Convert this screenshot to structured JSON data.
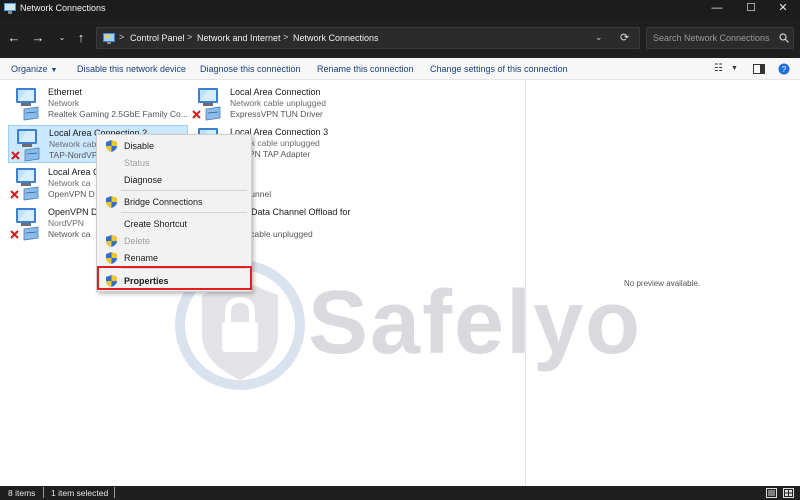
{
  "window": {
    "title": "Network Connections"
  },
  "window_controls": {
    "minimize": "—",
    "maximize": "☐",
    "close": "✕"
  },
  "nav": {
    "back": "←",
    "forward": "→",
    "recent": "⌄",
    "up": "↑"
  },
  "breadcrumb": {
    "items": [
      "Control Panel",
      "Network and Internet",
      "Network Connections"
    ],
    "separator": ">",
    "dropdown": "⌄",
    "refresh": "⟳"
  },
  "search": {
    "placeholder": "Search Network Connections"
  },
  "commands": {
    "organize": "Organize",
    "disable": "Disable this network device",
    "diagnose": "Diagnose this connection",
    "rename": "Rename this connection",
    "change": "Change settings of this connection"
  },
  "connections": [
    {
      "name": "Ethernet",
      "status": "Network",
      "device": "Realtek Gaming 2.5GbE Family Co...",
      "unplugged": false
    },
    {
      "name": "Local Area Connection",
      "status": "Network cable unplugged",
      "device": "ExpressVPN TUN Driver",
      "unplugged": true
    },
    {
      "name": "Local Area Connection 2",
      "status": "Network cab",
      "device": "TAP-NordVP",
      "unplugged": true,
      "selected": true
    },
    {
      "name": "Local Area Connection 3",
      "status": "etwork cable unplugged",
      "device": "essVPN TAP Adapter",
      "unplugged": true
    },
    {
      "name": "Local Area C",
      "status": "Network ca",
      "device": "OpenVPN D",
      "unplugged": true
    },
    {
      "name": "ynx",
      "status": "ynx",
      "device": "ynx Tunnel",
      "unplugged": true
    },
    {
      "name": "OpenVPN Da",
      "status": "NordVPN",
      "device": "Network ca",
      "unplugged": true
    },
    {
      "name": "VPN Data Channel Offload for",
      "status": "hark",
      "device": "work cable unplugged",
      "unplugged": true
    }
  ],
  "context_menu": {
    "disable": "Disable",
    "status": "Status",
    "diagnose": "Diagnose",
    "bridge": "Bridge Connections",
    "shortcut": "Create Shortcut",
    "delete": "Delete",
    "rename": "Rename",
    "properties": "Properties"
  },
  "preview": {
    "text": "No preview available."
  },
  "watermark": {
    "text": "Safelyo"
  },
  "statusbar": {
    "items_count": "8 items",
    "selected": "1 item selected"
  },
  "colors": {
    "accent": "#1b3f7a",
    "highlight": "#e0201f",
    "selection": "#cce8ff"
  }
}
